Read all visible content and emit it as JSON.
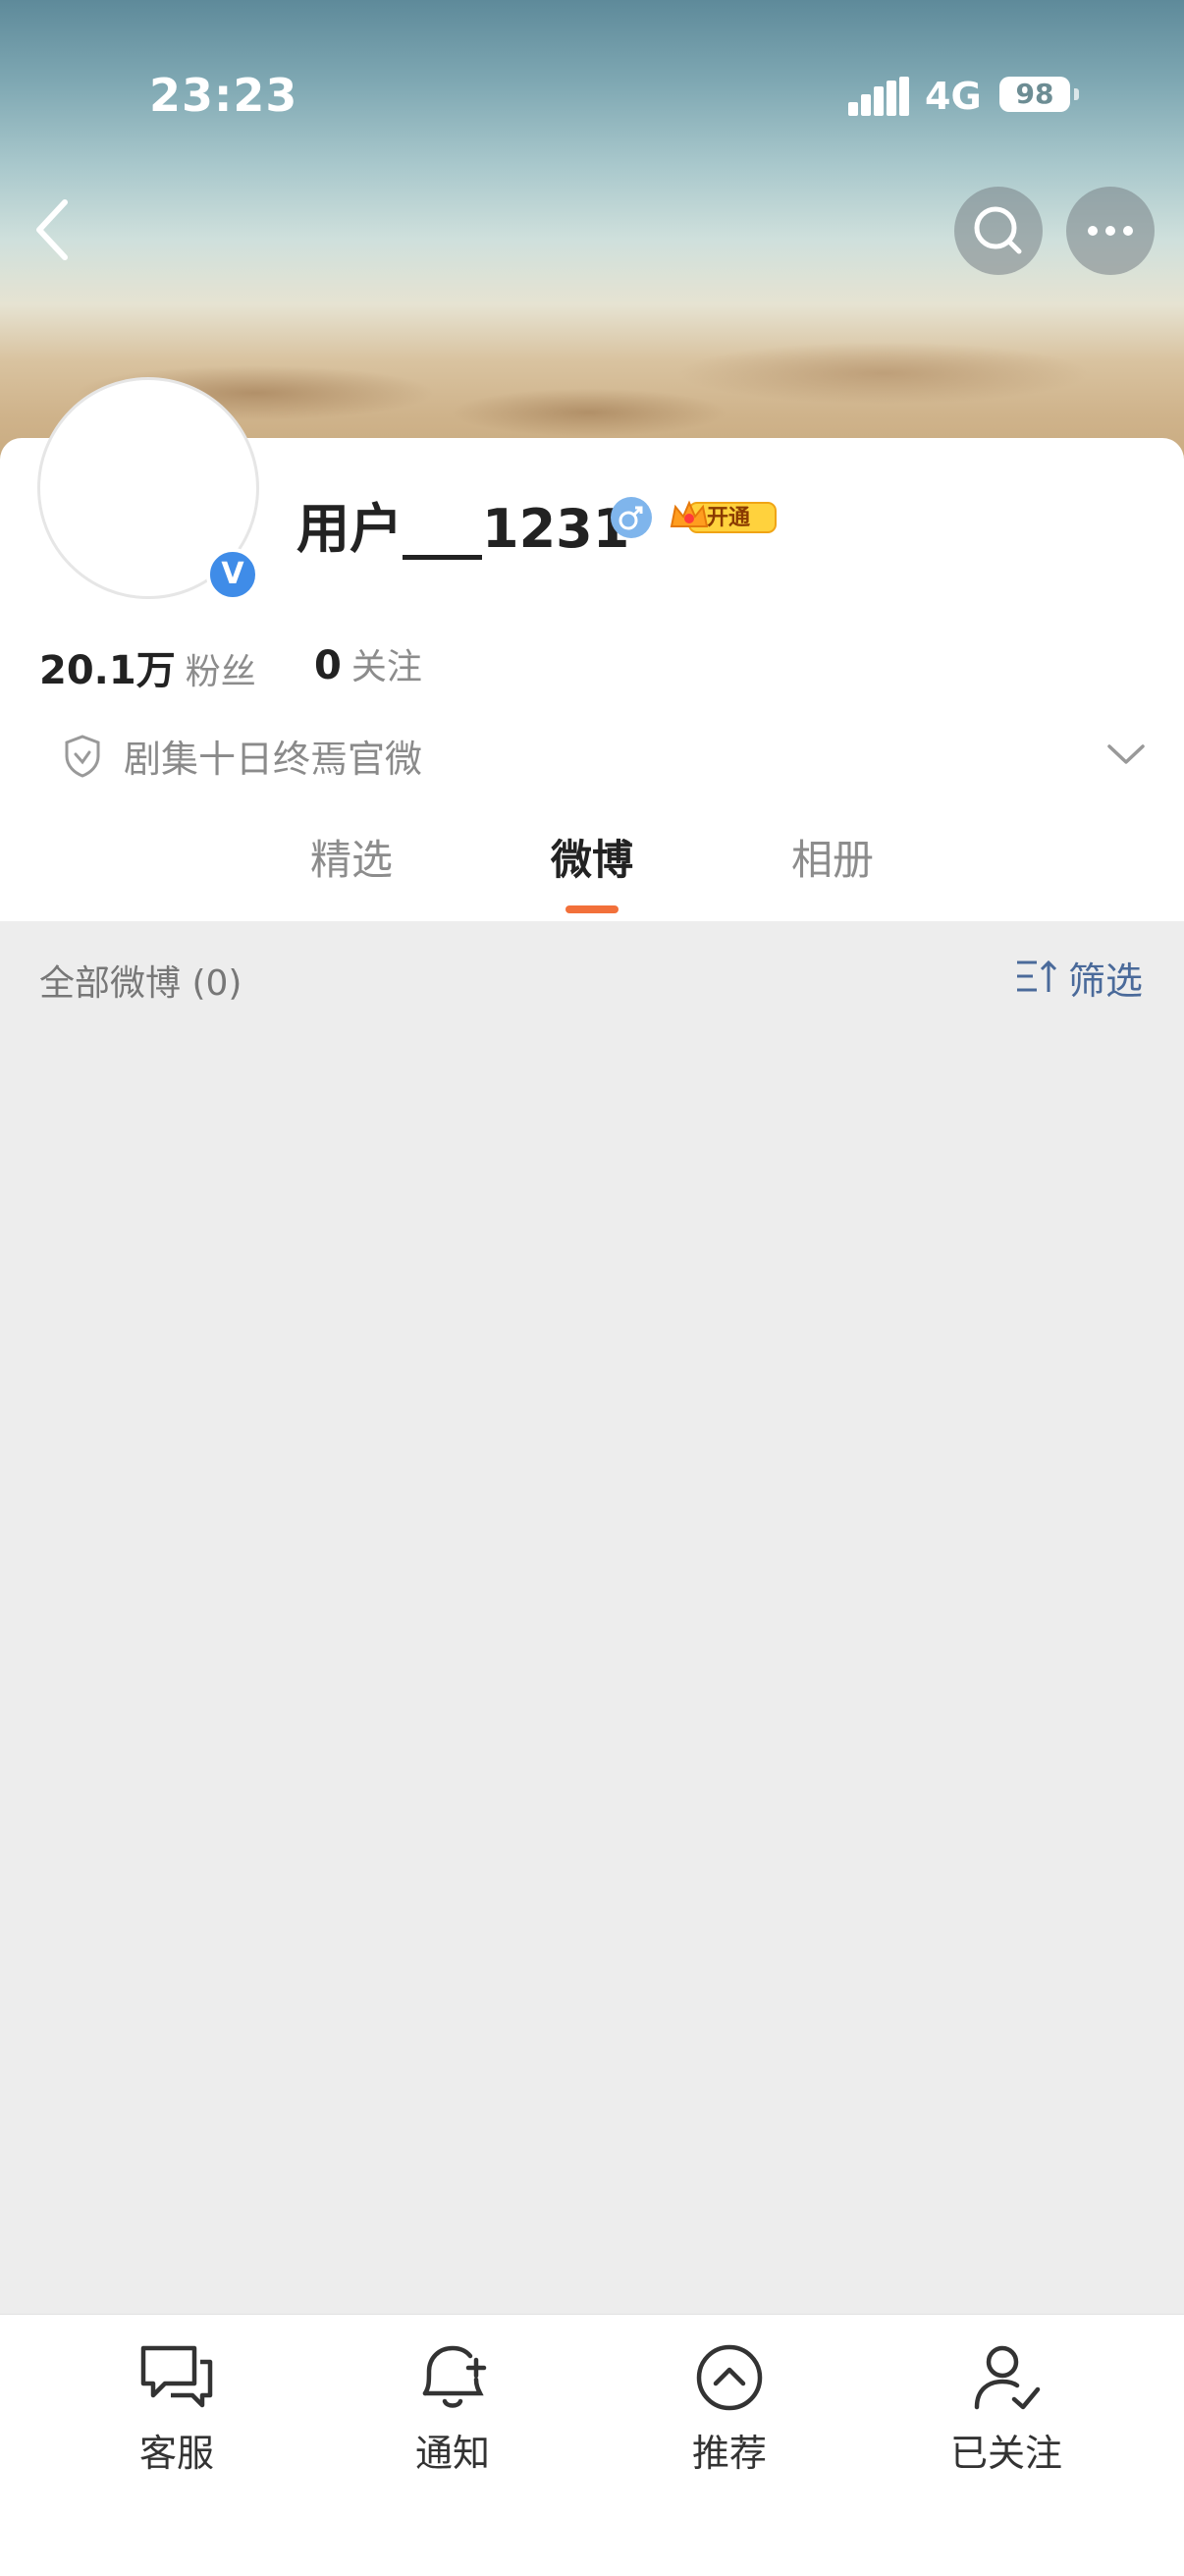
{
  "status_bar": {
    "time": "23:23",
    "network": "4G",
    "battery": "98"
  },
  "profile": {
    "username": "用户___1231",
    "vip_label": "开通",
    "fans_count": "20.1万",
    "fans_label": "粉丝",
    "following_count": "0",
    "following_label": "关注",
    "description": "剧集十日终焉官微"
  },
  "tabs": [
    {
      "label": "精选",
      "active": false
    },
    {
      "label": "微博",
      "active": true
    },
    {
      "label": "相册",
      "active": false
    }
  ],
  "feed": {
    "all_label": "全部微博 (0)",
    "filter_label": "筛选"
  },
  "bottom_bar": [
    {
      "label": "客服",
      "icon": "chat-icon"
    },
    {
      "label": "通知",
      "icon": "bell-plus-icon"
    },
    {
      "label": "推荐",
      "icon": "chevron-up-circle-icon"
    },
    {
      "label": "已关注",
      "icon": "user-check-icon"
    }
  ],
  "colors": {
    "accent": "#f2703a",
    "verified": "#3f8ce8",
    "filter": "#4a6a9a"
  }
}
